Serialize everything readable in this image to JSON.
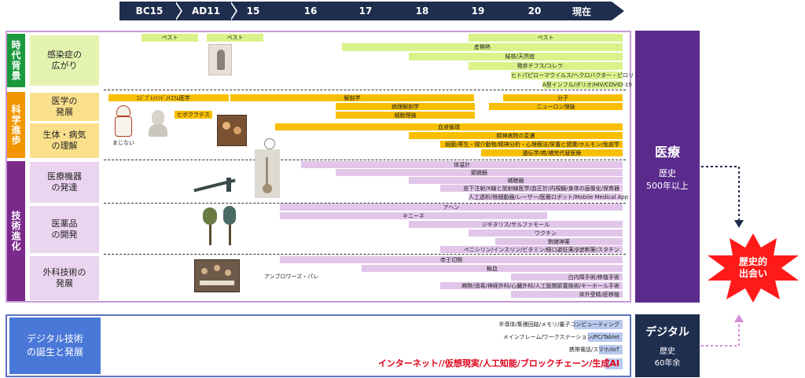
{
  "timeline": [
    "BC15",
    "AD11",
    "15",
    "16",
    "17",
    "18",
    "19",
    "20",
    "現在"
  ],
  "categories": {
    "era": "時代背景",
    "science": "科学進歩",
    "tech": "技術進化"
  },
  "subcategories": {
    "infection": [
      "感染症の",
      "広がり"
    ],
    "medicine": [
      "医学の",
      "発展"
    ],
    "body": [
      "生体・病気",
      "の理解"
    ],
    "devices": [
      "医療機器",
      "の発達"
    ],
    "drugs": [
      "医薬品",
      "の開発"
    ],
    "surgery": [
      "外科技術の",
      "発展"
    ],
    "digital": [
      "デジタル技術",
      "の誕生と発展"
    ]
  },
  "image_captions": {
    "majinai": "まじない",
    "hippocrates": "ヒポクラテス",
    "pare": "アンブロワーズ・パレ"
  },
  "bars": {
    "pest1": "ペスト",
    "pest2": "ペスト",
    "pest3": "ペスト",
    "sanjoku": "産褥熱",
    "kekkaku": "結核/天然痘",
    "typhus": "発疹チフス/コレラ",
    "pylori": "ヒトパピローマウイルス/ヘクロバクター・ピロリ",
    "flu": "A型インフル/ポリオ/HIV/COVID-19",
    "egypt": "ｴｼﾞﾌﾟﾄ/ｲﾝﾄﾞ/ｲｽﾗﾑ医学",
    "anatomy": "解剖学",
    "molecule": "分子",
    "pathology": "病理解剖学",
    "neuron": "ニューロン理論",
    "cell": "細胞理論",
    "circulation": "血液循環",
    "mental": "精神病院の変遷",
    "bacteria": "細菌/寄生・媒介動物/精神分析・心理療法/栄養と健康/ホルモン/免疫学",
    "genetics": "遺伝学/癌/補完代替医療",
    "thermometer": "体温計",
    "microscope": "顕微鏡",
    "hearing": "補聴器",
    "injection": "皮下注射/X線と放射線医学/血圧計/内視鏡/身体の画像化/保育器",
    "dialysis": "人工透析/除細動器/レーザー/医療ロボット/Mobile Medical App",
    "opium": "アヘン",
    "quinine": "キニーネ",
    "digitalis": "ジギタリス/サルファモール",
    "vaccine": "ワクチン",
    "antiparasitic": "駒猪神薬",
    "penicillin": "ペニシリン/インスリン/ビタミン/経口避妊薬/β遮断薬/スタチン",
    "caesarean": "帝王切開",
    "transfusion": "輸血",
    "cataract": "白内障手術/移植手術",
    "anesthesia": "麻酔/消毒/神経外科/心臓外科/人工股関節置換術/キーホール手術",
    "ivf": "体外受精/胚移植"
  },
  "digital_items": [
    "半導体/集積回路/メモリ/量子コンピューティング",
    "メインフレーム/ワークステーション/PC/Tablet",
    "携帯電話/スマホ/IoT",
    "インターネット//仮想現実/人工知能/ブロックチェーン/生成AI"
  ],
  "side_medical": {
    "title": "医療",
    "line1": "歴史",
    "line2": "500年以上"
  },
  "side_digital": {
    "title": "デジタル",
    "line1": "歴史",
    "line2": "60年余"
  },
  "burst": [
    "歴史的",
    "出会い"
  ],
  "colors": {
    "timeline": "#1f2d4e",
    "era": "#1a9a3c",
    "science": "#f29600",
    "tech": "#7a2a8a",
    "digital": "#3e6fd4",
    "side": "#5a2a8c",
    "side_digital": "#1f2d4e",
    "burst": "#ff1a1a"
  }
}
